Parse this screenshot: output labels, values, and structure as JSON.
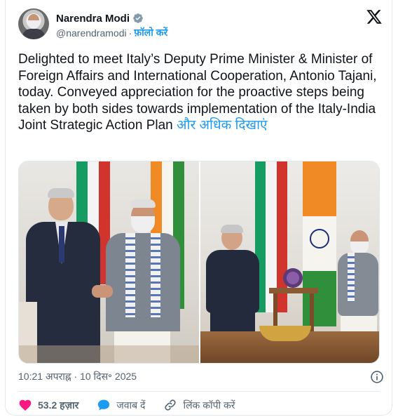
{
  "author": {
    "name": "Narendra Modi",
    "handle": "@narendramodi",
    "separator": "·",
    "follow_label": "फ़ॉलो करें"
  },
  "tweet": {
    "text": "Delighted to meet Italy’s Deputy Prime Minister & Minister of Foreign Affairs and International Cooperation, Antonio Tajani, today. Conveyed appreciation for the proactive steps being taken by both sides towards implementation of the Italy-India Joint Strategic Action Plan",
    "show_more": "और अधिक दिखाएं"
  },
  "meta": {
    "timestamp": "10:21 अपराह्न · 10 दिस॰ 2025"
  },
  "actions": {
    "likes": "53.2 हज़ार",
    "reply": "जवाब दें",
    "copy_link": "लिंक कॉपी करें"
  },
  "colors": {
    "accent": "#1d9bf0",
    "like": "#f91880",
    "text": "#0f1419",
    "muted": "#536471"
  },
  "icons": [
    "verified-badge-icon",
    "x-logo-icon",
    "info-icon",
    "heart-icon",
    "reply-bubble-icon",
    "link-icon"
  ]
}
